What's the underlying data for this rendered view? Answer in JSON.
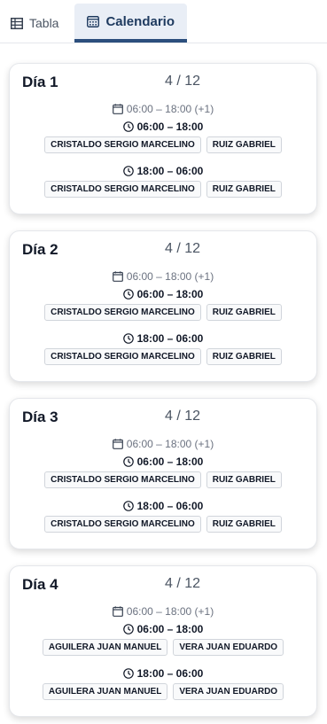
{
  "tabs": [
    {
      "label": "Tabla",
      "icon": "table-icon"
    },
    {
      "label": "Calendario",
      "icon": "calendar-icon"
    }
  ],
  "days": [
    {
      "label": "Día 1",
      "count": "4 / 12",
      "range": "06:00 – 18:00 (+1)",
      "shifts": [
        {
          "time": "06:00 – 18:00",
          "people": [
            "CRISTALDO SERGIO MARCELINO",
            "RUIZ GABRIEL"
          ]
        },
        {
          "time": "18:00 – 06:00",
          "people": [
            "CRISTALDO SERGIO MARCELINO",
            "RUIZ GABRIEL"
          ]
        }
      ]
    },
    {
      "label": "Día 2",
      "count": "4 / 12",
      "range": "06:00 – 18:00 (+1)",
      "shifts": [
        {
          "time": "06:00 – 18:00",
          "people": [
            "CRISTALDO SERGIO MARCELINO",
            "RUIZ GABRIEL"
          ]
        },
        {
          "time": "18:00 – 06:00",
          "people": [
            "CRISTALDO SERGIO MARCELINO",
            "RUIZ GABRIEL"
          ]
        }
      ]
    },
    {
      "label": "Día 3",
      "count": "4 / 12",
      "range": "06:00 – 18:00 (+1)",
      "shifts": [
        {
          "time": "06:00 – 18:00",
          "people": [
            "CRISTALDO SERGIO MARCELINO",
            "RUIZ GABRIEL"
          ]
        },
        {
          "time": "18:00 – 06:00",
          "people": [
            "CRISTALDO SERGIO MARCELINO",
            "RUIZ GABRIEL"
          ]
        }
      ]
    },
    {
      "label": "Día 4",
      "count": "4 / 12",
      "range": "06:00 – 18:00 (+1)",
      "shifts": [
        {
          "time": "06:00 – 18:00",
          "people": [
            "AGUILERA JUAN MANUEL",
            "VERA JUAN EDUARDO"
          ]
        },
        {
          "time": "18:00 – 06:00",
          "people": [
            "AGUILERA JUAN MANUEL",
            "VERA JUAN EDUARDO"
          ]
        }
      ]
    }
  ],
  "icons": {
    "range": "calendar-icon",
    "shift": "clock-icon"
  },
  "colors": {
    "accent": "#2c4f7d",
    "active_tab_bg": "#e9eef6"
  }
}
